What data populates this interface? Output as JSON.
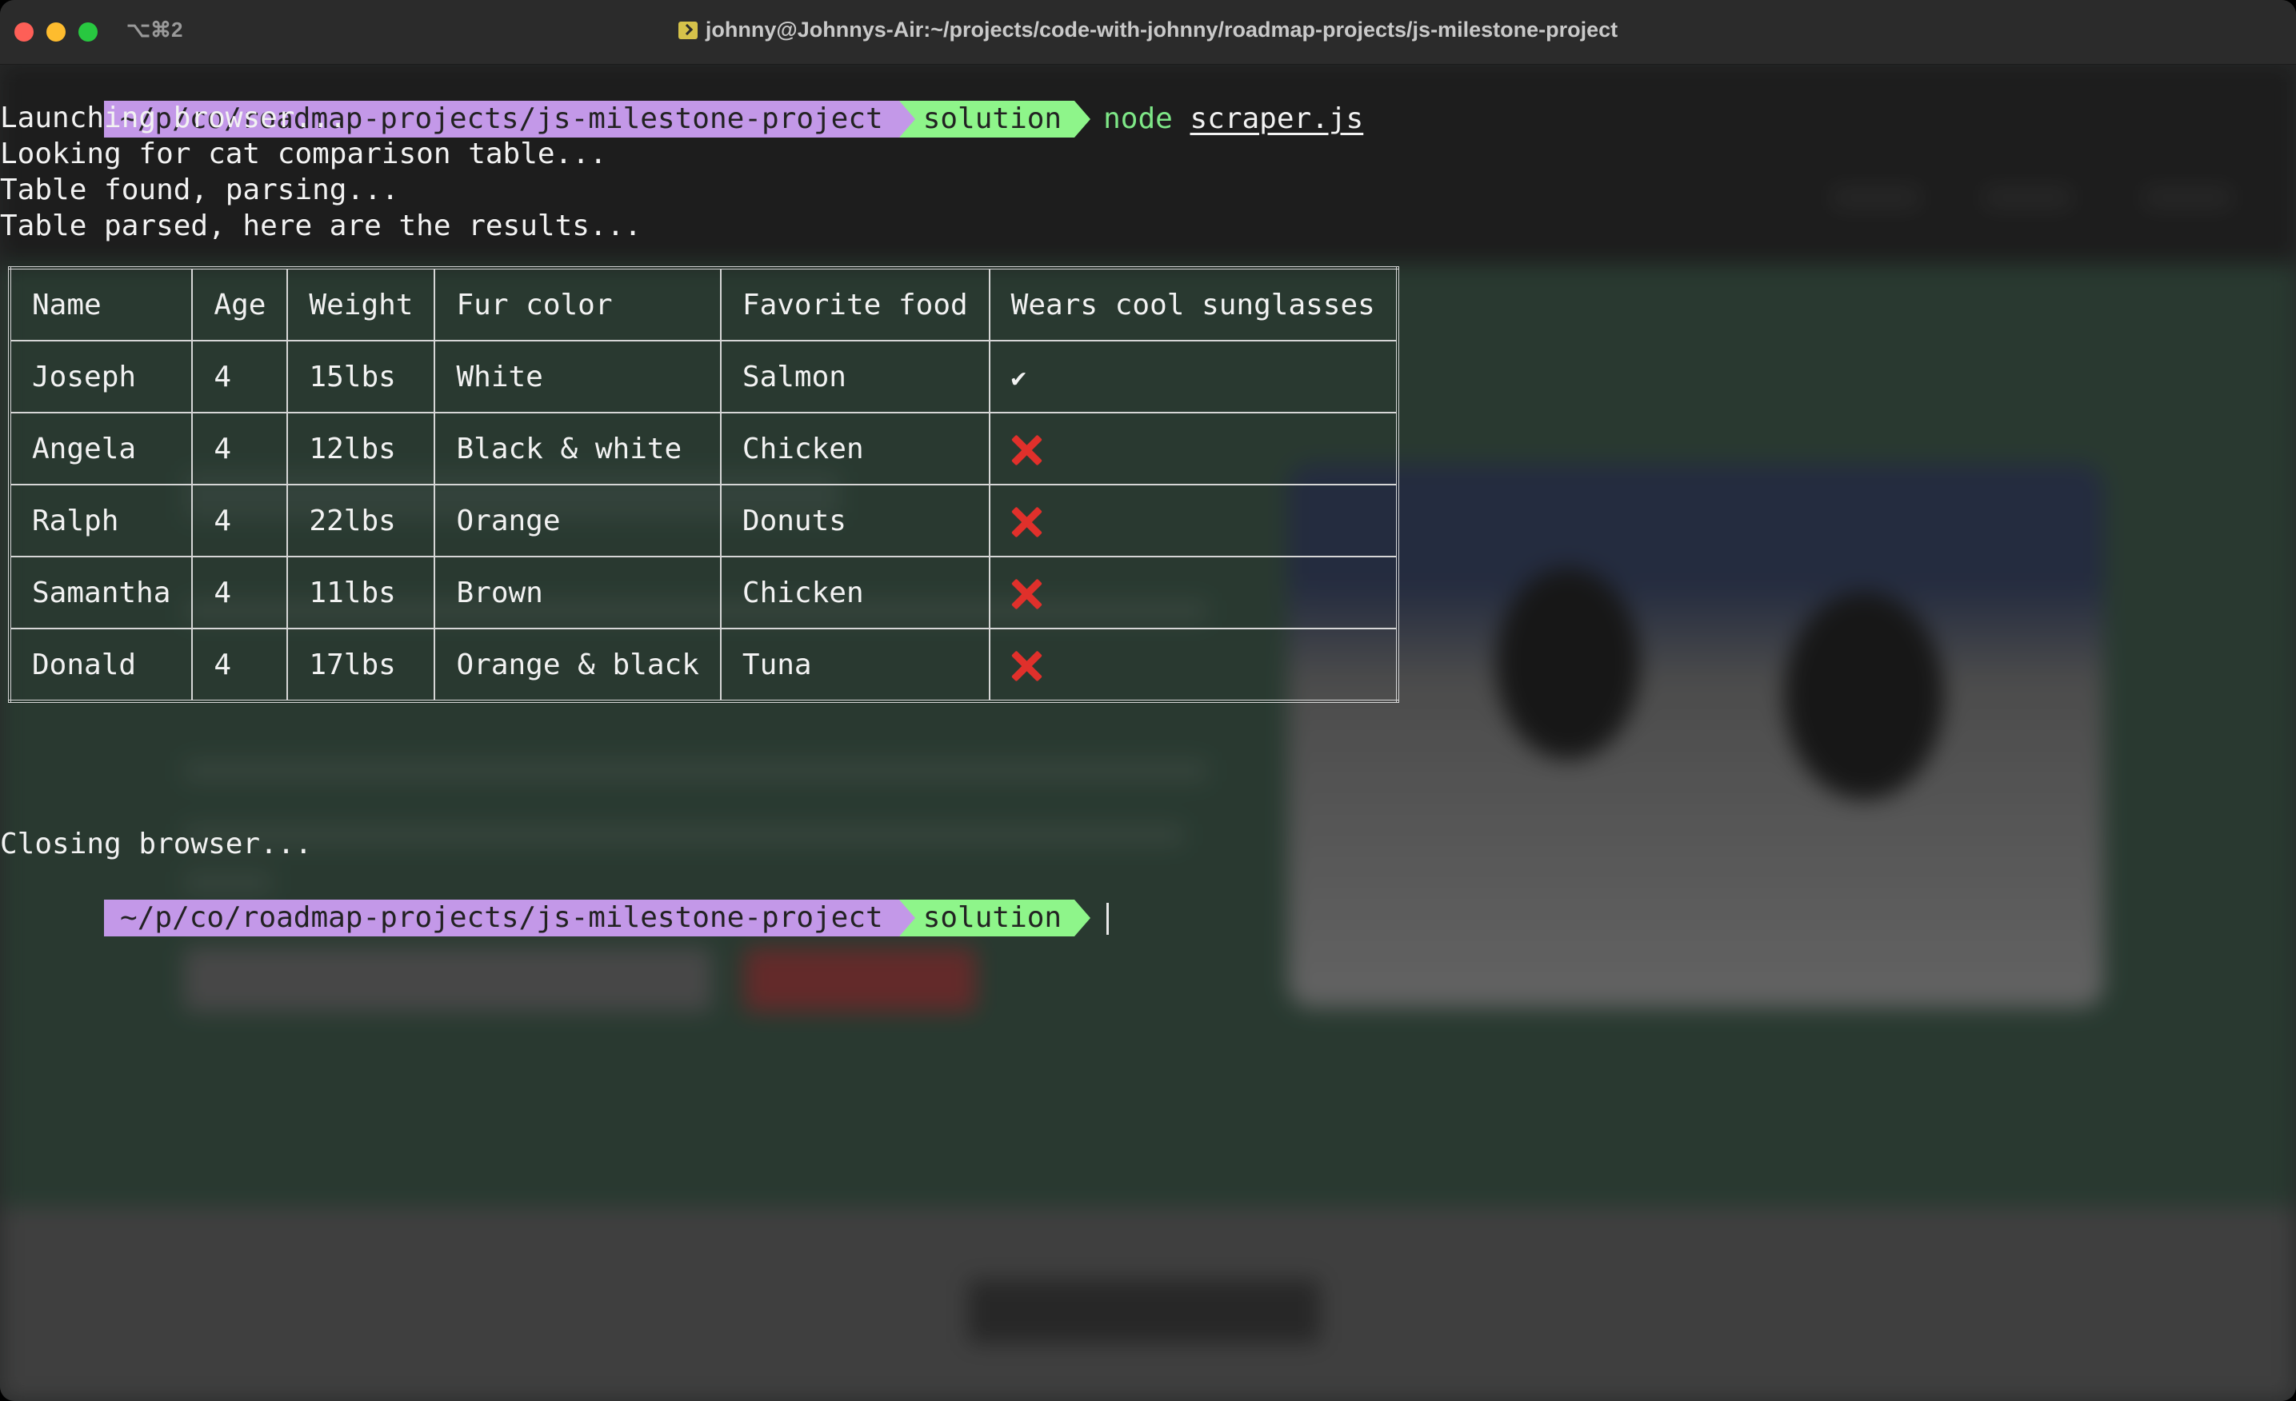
{
  "window": {
    "shortcut": "⌥⌘2",
    "title": "johnny@Johnnys-Air:~/projects/code-with-johnny/roadmap-projects/js-milestone-project"
  },
  "prompt": {
    "path": "~/p/co/roadmap-projects/js-milestone-project",
    "branch": "solution"
  },
  "command": {
    "program": "node",
    "argument": "scraper.js"
  },
  "output": {
    "line1": "Launching browser...",
    "line2": "Looking for cat comparison table...",
    "line3": "Table found, parsing...",
    "line4": "Table parsed, here are the results...",
    "closing": "Closing browser..."
  },
  "table": {
    "headers": [
      "Name",
      "Age",
      "Weight",
      "Fur color",
      "Favorite food",
      "Wears cool sunglasses"
    ],
    "rows": [
      {
        "name": "Joseph",
        "age": "4",
        "weight": "15lbs",
        "fur": "White",
        "food": "Salmon",
        "sunglasses": "✔",
        "sunglasses_icon": "checkmark-icon"
      },
      {
        "name": "Angela",
        "age": "4",
        "weight": "12lbs",
        "fur": "Black & white",
        "food": "Chicken",
        "sunglasses_icon": "cross-mark-icon"
      },
      {
        "name": "Ralph",
        "age": "4",
        "weight": "22lbs",
        "fur": "Orange",
        "food": "Donuts",
        "sunglasses_icon": "cross-mark-icon"
      },
      {
        "name": "Samantha",
        "age": "4",
        "weight": "11lbs",
        "fur": "Brown",
        "food": "Chicken",
        "sunglasses_icon": "cross-mark-icon"
      },
      {
        "name": "Donald",
        "age": "4",
        "weight": "17lbs",
        "fur": "Orange & black",
        "food": "Tuna",
        "sunglasses_icon": "cross-mark-icon"
      }
    ]
  },
  "colors": {
    "prompt_path_bg": "#c398e8",
    "prompt_branch_bg": "#8ef58a",
    "command_color": "#7ee787",
    "cross_color": "#e0302b"
  }
}
